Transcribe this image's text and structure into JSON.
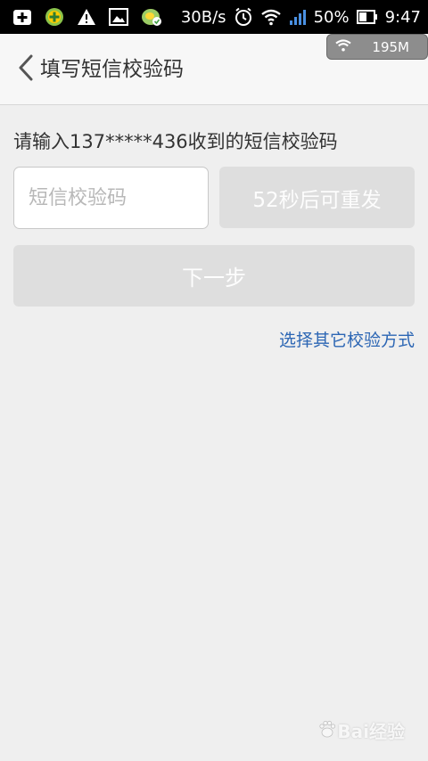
{
  "status_bar": {
    "speed": "30B/s",
    "battery": "50%",
    "time": "9:47",
    "icons": [
      "plus-box-icon",
      "shield-plus-icon",
      "warning-icon",
      "image-icon",
      "leaf-badge-icon",
      "alarm-icon",
      "wifi-icon",
      "signal-icon",
      "battery-icon"
    ]
  },
  "header": {
    "title": "填写短信校验码",
    "memory_badge": "195M"
  },
  "form": {
    "prompt": "请输入137*****436收到的短信校验码",
    "code_placeholder": "短信校验码",
    "code_value": "",
    "resend_label": "52秒后可重发",
    "next_label": "下一步",
    "other_method_link": "选择其它校验方式"
  },
  "watermark": {
    "text": "Bai经验"
  },
  "colors": {
    "background": "#efefef",
    "header_bg": "#f7f7f7",
    "button_disabled": "#dedede",
    "link": "#2c66b4",
    "text": "#333333"
  }
}
